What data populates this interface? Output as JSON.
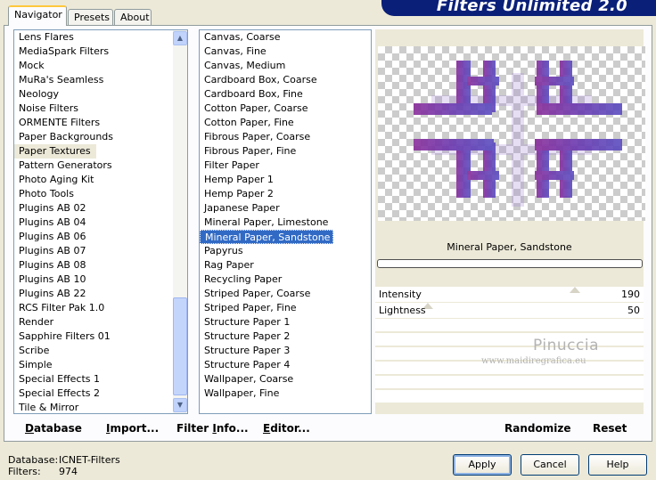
{
  "tabs": [
    {
      "label": "Navigator",
      "active": true
    },
    {
      "label": "Presets",
      "active": false
    },
    {
      "label": "About",
      "active": false
    }
  ],
  "banner_title": "Filters Unlimited 2.0",
  "categories": {
    "items": [
      "Lens Flares",
      "MediaSpark Filters",
      "Mock",
      "MuRa's Seamless",
      "Neology",
      "Noise Filters",
      "ORMENTE Filters",
      "Paper Backgrounds",
      "Paper Textures",
      "Pattern Generators",
      "Photo Aging Kit",
      "Photo Tools",
      "Plugins AB 02",
      "Plugins AB 04",
      "Plugins AB 06",
      "Plugins AB 07",
      "Plugins AB 08",
      "Plugins AB 10",
      "Plugins AB 22",
      "RCS Filter Pak 1.0",
      "Render",
      "Sapphire Filters 01",
      "Scribe",
      "Simple",
      "Special Effects 1",
      "Special Effects 2",
      "Tile & Mirror"
    ],
    "selected": "Paper Textures"
  },
  "filters": {
    "items": [
      "Canvas, Coarse",
      "Canvas, Fine",
      "Canvas, Medium",
      "Cardboard Box, Coarse",
      "Cardboard Box, Fine",
      "Cotton Paper, Coarse",
      "Cotton Paper, Fine",
      "Fibrous Paper, Coarse",
      "Fibrous Paper, Fine",
      "Filter Paper",
      "Hemp Paper 1",
      "Hemp Paper 2",
      "Japanese Paper",
      "Mineral Paper, Limestone",
      "Mineral Paper, Sandstone",
      "Papyrus",
      "Rag Paper",
      "Recycling Paper",
      "Striped Paper, Coarse",
      "Striped Paper, Fine",
      "Structure Paper 1",
      "Structure Paper 2",
      "Structure Paper 3",
      "Structure Paper 4",
      "Wallpaper, Coarse",
      "Wallpaper, Fine"
    ],
    "selected": "Mineral Paper, Sandstone"
  },
  "current_filter": "Mineral Paper, Sandstone",
  "params": [
    {
      "label": "Intensity",
      "value": "190",
      "level": 0.745
    },
    {
      "label": "Lightness",
      "value": "50",
      "level": 0.196
    }
  ],
  "watermark": {
    "name": "Pinuccia",
    "url": "www.maidiregrafica.eu"
  },
  "buttons": {
    "database": {
      "u": "D",
      "rest": "atabase"
    },
    "import": {
      "u": "I",
      "rest": "mport..."
    },
    "filter_info": {
      "pre": "Filter ",
      "u": "I",
      "rest": "nfo..."
    },
    "editor": {
      "u": "E",
      "rest": "ditor..."
    },
    "randomize": "Randomize",
    "reset": "Reset",
    "apply": "Apply",
    "cancel": "Cancel",
    "help": "Help"
  },
  "status": {
    "database_label": "Database:",
    "database_value": "ICNET-Filters",
    "filters_label": "Filters:",
    "filters_value": "974"
  },
  "colors": {
    "selection": "#316ac5",
    "banner": "#0a1f78",
    "artwork_purple": "#6a2fa0"
  }
}
